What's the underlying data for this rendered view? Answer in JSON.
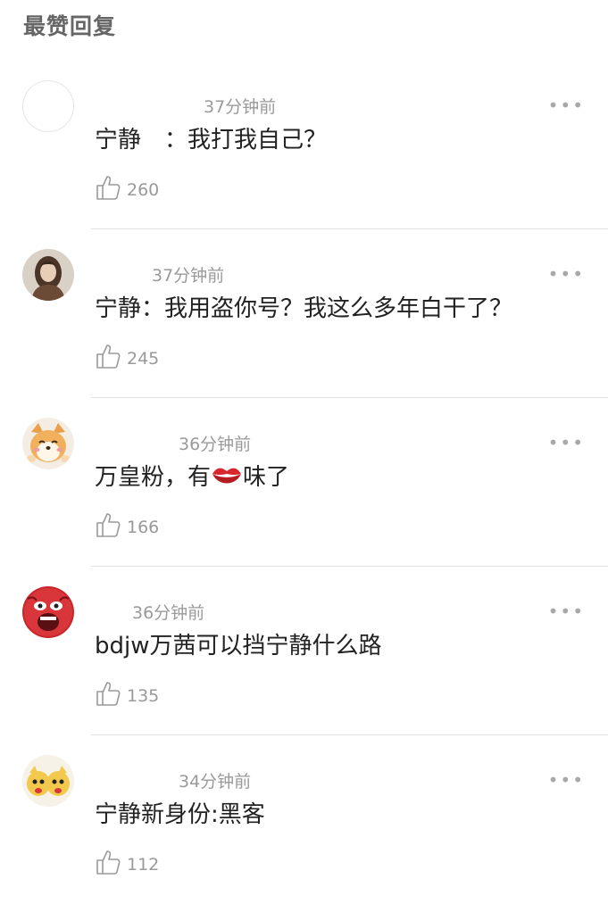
{
  "section": {
    "title": "最赞回复"
  },
  "comments": [
    {
      "time": "37分钟前",
      "content_before": "宁静　：我打我自己？",
      "content_after": "",
      "likes": "260"
    },
    {
      "time": "37分钟前",
      "content_before": "宁静：我用盗你号？我这么多年白干了？",
      "content_after": "",
      "likes": "245"
    },
    {
      "time": "36分钟前",
      "content_before": "万皇粉，有",
      "emoji": "lips-emoji",
      "content_after": "味了",
      "likes": "166"
    },
    {
      "time": "36分钟前",
      "content_before": "bdjw万茜可以挡宁静什么路",
      "content_after": "",
      "likes": "135"
    },
    {
      "time": "34分钟前",
      "content_before": "宁静新身份:黑客",
      "content_after": "",
      "likes": "112"
    }
  ],
  "more_label": "•••",
  "colors": {
    "text": "#222222",
    "muted": "#9a9a9a",
    "divider": "#e2e2e2",
    "title": "#666666"
  }
}
